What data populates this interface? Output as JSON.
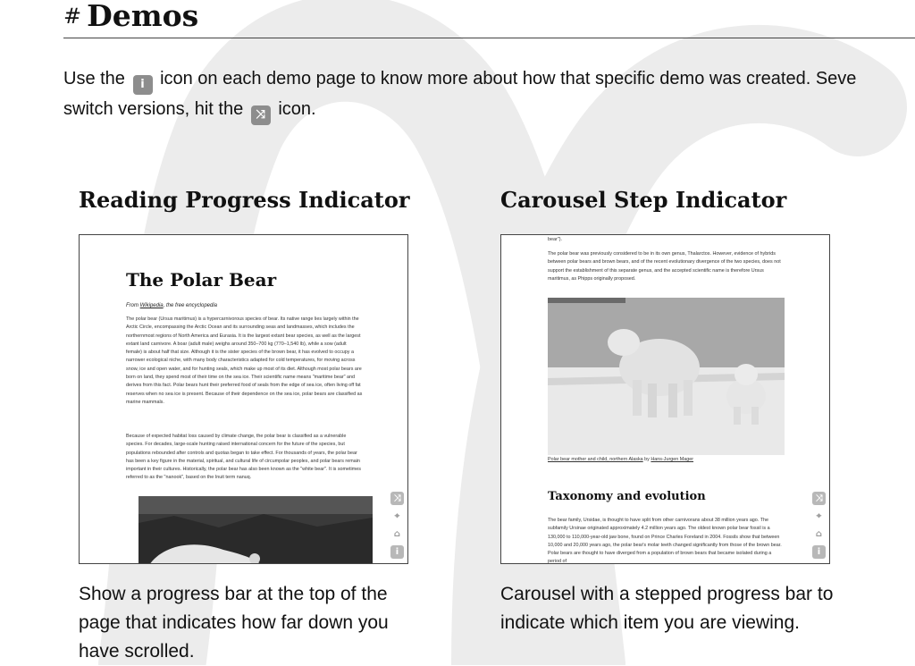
{
  "page": {
    "hash": "#",
    "title": "Demos",
    "intro": {
      "line1_before": "Use the",
      "line1_after": "icon on each demo page to know more about how that specific demo was created. Seve",
      "line2_before": "switch versions, hit the",
      "line2_after": "icon.",
      "info_icon": "info-icon",
      "shuffle_icon": "shuffle-icon"
    }
  },
  "demos": [
    {
      "title": "Reading Progress Indicator",
      "description": "Show a progress bar at the top of the page that indicates how far down you have scrolled.",
      "preview": {
        "article_title": "The Polar Bear",
        "from_prefix": "From",
        "from_link": "Wikipedia",
        "from_suffix": ", the free encyclopedia",
        "paragraph1": "The polar bear (Ursus maritimus) is a hypercarnivorous species of bear. Its native range lies largely within the Arctic Circle, encompassing the Arctic Ocean and its surrounding seas and landmasses, which includes the northernmost regions of North America and Eurasia. It is the largest extant bear species, as well as the largest extant land carnivore. A boar (adult male) weighs around 350–700 kg (770–1,540 lb), while a sow (adult female) is about half that size. Although it is the sister species of the brown bear, it has evolved to occupy a narrower ecological niche, with many body characteristics adapted for cold temperatures, for moving across snow, ice and open water, and for hunting seals, which make up most of its diet. Although most polar bears are born on land, they spend most of their time on the sea ice. Their scientific name means \"maritime bear\" and derives from this fact. Polar bears hunt their preferred food of seals from the edge of sea ice, often living off fat reserves when no sea ice is present. Because of their dependence on the sea ice, polar bears are classified as marine mammals.",
        "paragraph2": "Because of expected habitat loss caused by climate change, the polar bear is classified as a vulnerable species. For decades, large-scale hunting raised international concern for the future of the species, but populations rebounded after controls and quotas began to take effect. For thousands of years, the polar bear has been a key figure in the material, spiritual, and cultural life of circumpolar peoples, and polar bears remain important in their cultures. Historically, the polar bear has also been known as the \"white bear\". It is sometimes referred to as the \"nanook\", based on the Inuit term nanuq."
      }
    },
    {
      "title": "Carousel Step Indicator",
      "description": "Carousel with a stepped progress bar to indicate which item you are viewing.",
      "preview": {
        "top_fragment": "bear\").",
        "paragraph1": "The polar bear was previously considered to be in its own genus, Thalarctos. However, evidence of hybrids between polar bears and brown bears, and of the recent evolutionary divergence of the two species, does not support the establishment of this separate genus, and the accepted scientific name is therefore Ursus maritimus, as Phipps originally proposed.",
        "carousel_progress": 0.33,
        "caption_link1": "Polar bear mother and child, northern Alaska",
        "caption_by": " by ",
        "caption_link2": "Hans-Jurgen Mager",
        "section_title": "Taxonomy and evolution",
        "paragraph2": "The bear family, Ursidae, is thought to have split from other carnivorans about 38 million years ago. The subfamily Ursinae originated approximately 4.2 million years ago. The oldest known polar bear fossil is a 130,000 to 110,000-year-old jaw bone, found on Prince Charles Foreland in 2004. Fossils show that between 10,000 and 20,000 years ago, the polar bear's molar teeth changed significantly from those of the brown bear. Polar bears are thought to have diverged from a population of brown bears that became isolated during a period of"
      }
    }
  ],
  "overlay_icons": [
    "shuffle-icon",
    "cursor-icon",
    "home-icon",
    "info-icon"
  ]
}
